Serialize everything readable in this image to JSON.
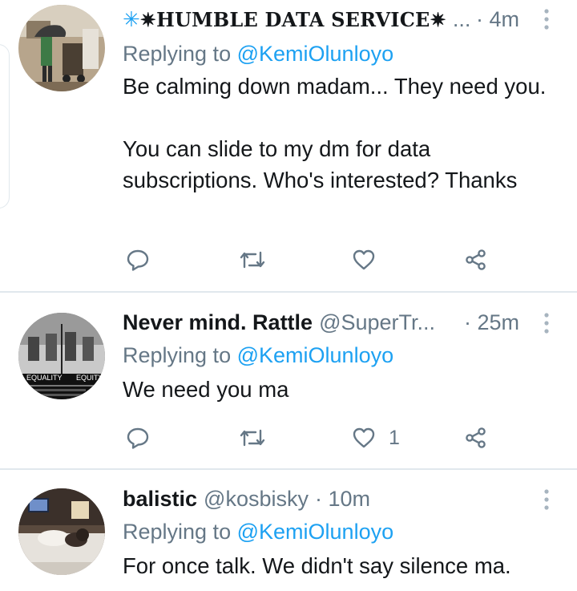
{
  "tweets": [
    {
      "name": "✴️HUMBLE DATA SERVICE✴️",
      "name_display": "✷HUMBLE DATA SERVICE✷",
      "handle": "...",
      "time": "· 4m",
      "replying_prefix": "Replying to",
      "replying_to": "@KemiOlunloyo",
      "text": [
        "Be calming down madam... They need you.",
        "You can slide to my dm for data subscriptions. Who's interested? Thanks"
      ],
      "likes": ""
    },
    {
      "name": "Never mind. Rattle",
      "handle": "@SuperTr...",
      "time": "· 25m",
      "replying_prefix": "Replying to",
      "replying_to": "@KemiOlunloyo",
      "text": [
        "We need you ma"
      ],
      "likes": "1",
      "avatar_caption": [
        "EQUALITY",
        "EQUITY"
      ]
    },
    {
      "name": "balistic",
      "handle": "@kosbisky",
      "time": "· 10m",
      "replying_prefix": "Replying to",
      "replying_to": "@KemiOlunloyo",
      "text": [
        "For once talk. We didn't say silence ma."
      ]
    }
  ],
  "icons": {
    "reply": "reply-icon",
    "retweet": "retweet-icon",
    "like": "like-icon",
    "share": "share-icon",
    "more": "more-icon"
  },
  "colors": {
    "link": "#1da1f2",
    "secondary": "#657786",
    "divider": "#e1e8ed"
  }
}
